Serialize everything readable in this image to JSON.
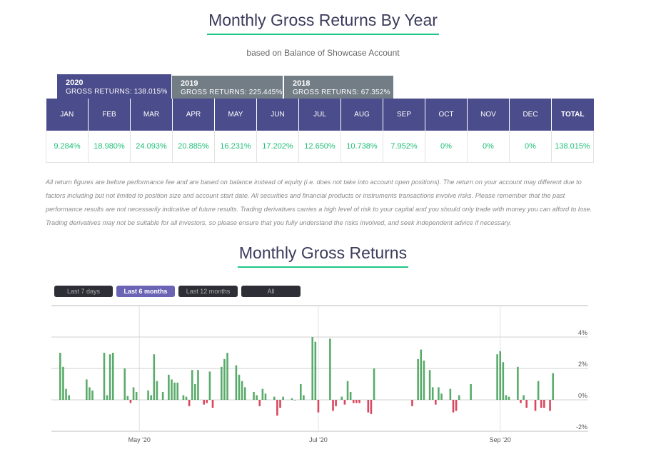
{
  "header": {
    "title": "Monthly Gross Returns By Year",
    "subtitle": "based on Balance of Showcase Account"
  },
  "year_tabs": [
    {
      "year": "2020",
      "gross": "GROSS RETURNS: 138.015%",
      "active": true
    },
    {
      "year": "2019",
      "gross": "GROSS RETURNS: 225.445%",
      "active": false
    },
    {
      "year": "2018",
      "gross": "GROSS RETURNS: 67.352%",
      "active": false
    }
  ],
  "table": {
    "headers": [
      "JAN",
      "FEB",
      "MAR",
      "APR",
      "MAY",
      "JUN",
      "JUL",
      "AUG",
      "SEP",
      "OCT",
      "NOV",
      "DEC",
      "TOTAL"
    ],
    "values": [
      "9.284%",
      "18.980%",
      "24.093%",
      "20.885%",
      "16.231%",
      "17.202%",
      "12.650%",
      "10.738%",
      "7.952%",
      "0%",
      "0%",
      "0%",
      "138.015%"
    ]
  },
  "disclaimer": "All return figures are before performance fee and are based on balance instead of equity (i.e. does not take into account open positions). The return on your account may different due to factors including but not limited to position size and account start date. All securities and financial products or instruments transactions involve risks. Please remember that the past performance results are not necessarily indicative of future results. Trading derivatives carries a high level of risk to your capital and you should only trade with money you can afford to lose. Trading derivatives may not be suitable for all investors, so please ensure that you fully understand the risks involved, and seek independent advice if necessary.",
  "chart_section": {
    "title": "Monthly Gross Returns",
    "range_buttons": [
      "Last 7 days",
      "Last 6 months",
      "Last 12 months",
      "All"
    ],
    "active_range": "Last 6 months"
  },
  "colors": {
    "accent": "#4b4c8b",
    "inactive_tab": "#737d86",
    "positive": "#1ebf76",
    "bar_positive": "#5aab6b",
    "bar_negative": "#d9475e",
    "underline": "#1fc787"
  },
  "chart_data": {
    "type": "bar",
    "title": "",
    "xlabel": "",
    "ylabel": "",
    "ylim": [
      -2,
      6
    ],
    "y_ticks": [
      "4%",
      "2%",
      "0%",
      "-2%"
    ],
    "y_tick_values": [
      4,
      2,
      0,
      -2
    ],
    "x_labels": [
      "May '20",
      "Jul '20",
      "Sep '20"
    ],
    "x_label_days": [
      30,
      91,
      153
    ],
    "start_day": 0,
    "end_day": 183,
    "series": [
      {
        "values": [
          [
            3,
            3.0
          ],
          [
            4,
            2.1
          ],
          [
            5,
            0.7
          ],
          [
            6,
            0.3
          ],
          [
            12,
            1.3
          ],
          [
            13,
            0.8
          ],
          [
            14,
            0.6
          ],
          [
            18,
            3.0
          ],
          [
            19,
            0.3
          ],
          [
            20,
            2.9
          ],
          [
            21,
            3.0
          ],
          [
            25,
            2.0
          ],
          [
            26,
            0.25
          ],
          [
            27,
            -0.2
          ],
          [
            28,
            0.8
          ],
          [
            29,
            0.5
          ],
          [
            33,
            0.6
          ],
          [
            34,
            0.3
          ],
          [
            35,
            2.9
          ],
          [
            36,
            1.2
          ],
          [
            38,
            0.5
          ],
          [
            40,
            1.6
          ],
          [
            41,
            1.3
          ],
          [
            42,
            1.1
          ],
          [
            43,
            1.1
          ],
          [
            45,
            0.3
          ],
          [
            46,
            0.2
          ],
          [
            47,
            -0.4
          ],
          [
            48,
            1.9
          ],
          [
            49,
            1.0
          ],
          [
            50,
            1.9
          ],
          [
            52,
            -0.3
          ],
          [
            53,
            -0.2
          ],
          [
            54,
            1.8
          ],
          [
            55,
            -0.5
          ],
          [
            58,
            2.1
          ],
          [
            59,
            2.6
          ],
          [
            60,
            3.0
          ],
          [
            63,
            2.2
          ],
          [
            64,
            1.6
          ],
          [
            65,
            1.2
          ],
          [
            66,
            0.8
          ],
          [
            69,
            0.5
          ],
          [
            70,
            0.3
          ],
          [
            71,
            -0.4
          ],
          [
            72,
            0.7
          ],
          [
            73,
            0.4
          ],
          [
            76,
            0.2
          ],
          [
            77,
            -1.0
          ],
          [
            78,
            -0.5
          ],
          [
            79,
            0.2
          ],
          [
            82,
            0.1
          ],
          [
            83,
            0.0
          ],
          [
            85,
            1.0
          ],
          [
            86,
            0.3
          ],
          [
            89,
            4.0
          ],
          [
            90,
            3.7
          ],
          [
            91,
            -0.8
          ],
          [
            95,
            3.9
          ],
          [
            96,
            -0.7
          ],
          [
            97,
            -0.4
          ],
          [
            99,
            0.2
          ],
          [
            100,
            -0.3
          ],
          [
            101,
            1.2
          ],
          [
            102,
            0.5
          ],
          [
            103,
            -0.2
          ],
          [
            104,
            -0.2
          ],
          [
            105,
            -0.2
          ],
          [
            108,
            -0.8
          ],
          [
            109,
            -0.9
          ],
          [
            110,
            2.0
          ],
          [
            123,
            -0.4
          ],
          [
            125,
            2.6
          ],
          [
            126,
            3.2
          ],
          [
            127,
            2.5
          ],
          [
            129,
            1.9
          ],
          [
            130,
            0.8
          ],
          [
            131,
            -0.3
          ],
          [
            132,
            0.8
          ],
          [
            133,
            0.4
          ],
          [
            136,
            0.7
          ],
          [
            137,
            -0.8
          ],
          [
            138,
            -0.7
          ],
          [
            139,
            0.3
          ],
          [
            143,
            1.0
          ],
          [
            152,
            2.9
          ],
          [
            153,
            3.1
          ],
          [
            154,
            2.4
          ],
          [
            155,
            0.3
          ],
          [
            156,
            0.2
          ],
          [
            159,
            2.1
          ],
          [
            160,
            -0.2
          ],
          [
            161,
            0.3
          ],
          [
            162,
            -0.5
          ],
          [
            165,
            -0.7
          ],
          [
            166,
            1.2
          ],
          [
            167,
            -0.5
          ],
          [
            168,
            -0.5
          ],
          [
            170,
            -0.7
          ],
          [
            171,
            1.7
          ]
        ]
      }
    ]
  }
}
